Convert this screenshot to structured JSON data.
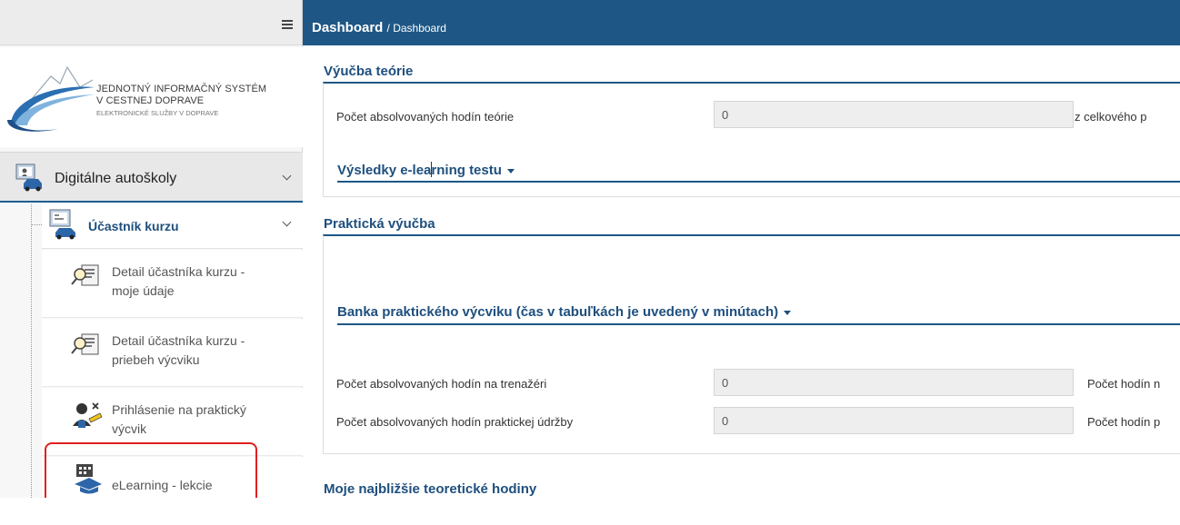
{
  "sidebar": {
    "logo": {
      "line1": "JEDNOTNÝ INFORMAČNÝ SYSTÉM",
      "line2": "V CESTNEJ DOPRAVE",
      "line3": "ELEKTRONICKÉ SLUŽBY V DOPRAVE"
    },
    "main_menu": {
      "label": "Digitálne autoškoly"
    },
    "sub_menu": {
      "label": "Účastník kurzu"
    },
    "items": [
      {
        "label_line1": "Detail účastníka kurzu -",
        "label_line2": "moje údaje"
      },
      {
        "label_line1": "Detail účastníka kurzu -",
        "label_line2": "priebeh výcviku"
      },
      {
        "label_line1": "Prihlásenie na praktický",
        "label_line2": "výcvik"
      },
      {
        "label_line1": "eLearning - lekcie",
        "label_line2": ""
      }
    ]
  },
  "header": {
    "title": "Dashboard",
    "breadcrumb": "/ Dashboard"
  },
  "theory": {
    "title": "Výučba teórie",
    "hours_label": "Počet absolvovaných hodín teórie",
    "hours_value": "0",
    "hours_suffix": "z celkového p",
    "elearning_title_a": "Výsledky e-lea",
    "elearning_title_b": "rning testu"
  },
  "practice": {
    "title": "Praktická výučba",
    "bank_title": "Banka praktického výcviku (čas v tabuľkách je uvedený v minútach)",
    "simulator_label": "Počet absolvovaných hodín na trenažéri",
    "simulator_value": "0",
    "simulator_suffix": "Počet hodín n",
    "maintenance_label": "Počet absolvovaných hodín praktickej údržby",
    "maintenance_value": "0",
    "maintenance_suffix": "Počet hodín p"
  },
  "upcoming": {
    "title": "Moje najbližšie teoretické hodiny"
  },
  "colors": {
    "brand": "#1e5785",
    "highlight": "#e02020"
  }
}
